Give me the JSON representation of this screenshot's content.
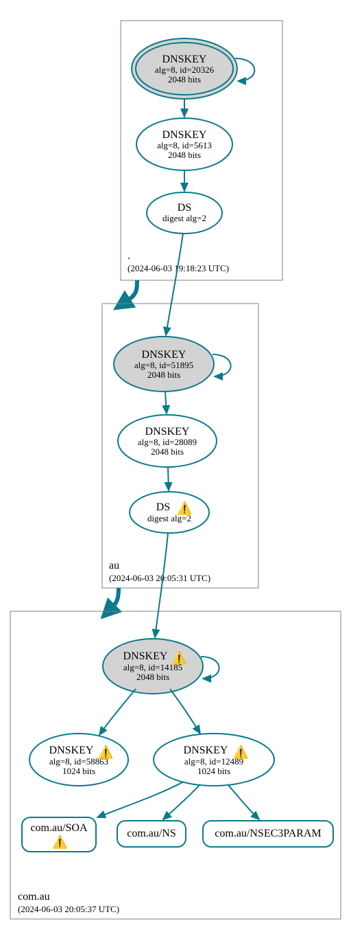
{
  "zones": {
    "root": {
      "name": ".",
      "timestamp": "(2024-06-03 19:18:23 UTC)"
    },
    "au": {
      "name": "au",
      "timestamp": "(2024-06-03 20:05:31 UTC)"
    },
    "comau": {
      "name": "com.au",
      "timestamp": "(2024-06-03 20:05:37 UTC)"
    }
  },
  "nodes": {
    "root_ksk": {
      "l1": "DNSKEY",
      "l2": "alg=8, id=20326",
      "l3": "2048 bits"
    },
    "root_zsk": {
      "l1": "DNSKEY",
      "l2": "alg=8, id=5613",
      "l3": "2048 bits"
    },
    "root_ds": {
      "l1": "DS",
      "l2": "digest alg=2"
    },
    "au_ksk": {
      "l1": "DNSKEY",
      "l2": "alg=8, id=51895",
      "l3": "2048 bits"
    },
    "au_zsk": {
      "l1": "DNSKEY",
      "l2": "alg=8, id=28089",
      "l3": "2048 bits"
    },
    "au_ds": {
      "l1": "DS",
      "l2": "digest alg=2"
    },
    "comau_ksk": {
      "l1": "DNSKEY",
      "l2": "alg=8, id=14185",
      "l3": "2048 bits"
    },
    "comau_zsk1": {
      "l1": "DNSKEY",
      "l2": "alg=8, id=58863",
      "l3": "1024 bits"
    },
    "comau_zsk2": {
      "l1": "DNSKEY",
      "l2": "alg=8, id=12489",
      "l3": "1024 bits"
    }
  },
  "rr": {
    "soa": "com.au/SOA",
    "ns": "com.au/NS",
    "nsec": "com.au/NSEC3PARAM"
  },
  "icons": {
    "warn": "⚠️"
  }
}
